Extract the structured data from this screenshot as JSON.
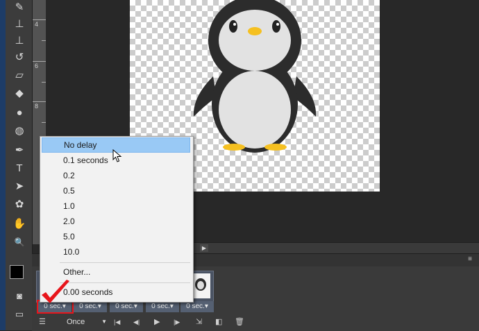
{
  "ruler": {
    "labels": [
      "4",
      "6",
      "8"
    ]
  },
  "tools": [
    "brush-icon",
    "stamp-icon",
    "history-brush-icon",
    "eraser-icon",
    "bucket-icon",
    "blur-icon",
    "dodge-icon",
    "pen-icon",
    "type-icon",
    "path-select-icon",
    "shape-icon",
    "hand-icon",
    "zoom-icon"
  ],
  "tool_glyphs": {
    "brush": "✎",
    "stamp": "⊥",
    "history": "↺",
    "eraser": "▱",
    "bucket": "◆",
    "blur": "●",
    "dodge": "◍",
    "pen": "✒",
    "type": "T",
    "select": "➤",
    "shape": "✿",
    "hand": "✋",
    "zoom": "🔍",
    "fg": "■",
    "quickmask": "◙",
    "screen": "▭"
  },
  "delay_menu": {
    "items": [
      "No delay",
      "0.1 seconds",
      "0.2",
      "0.5",
      "1.0",
      "2.0",
      "5.0",
      "10.0"
    ],
    "other": "Other...",
    "current": "0.00 seconds"
  },
  "frames": {
    "delays": [
      "0 sec.▾",
      "0 sec.▾",
      "0 sec.▾",
      "0 sec.▾",
      "0 sec.▾"
    ]
  },
  "controls": {
    "loop": "Once",
    "loop_arrow": "▼",
    "first": "|◀",
    "prev": "◀|",
    "play": "▶",
    "next": "|▶",
    "tween": "⇲",
    "new_frame": "◧",
    "delete": "🗑",
    "convert": "☰"
  },
  "scroll": {
    "arrow": "▶"
  },
  "panel_menu": "≡",
  "colors": {
    "menu_highlight": "#99c9f5",
    "frame_bg": "#556072",
    "checkmark": "#e8151b"
  }
}
